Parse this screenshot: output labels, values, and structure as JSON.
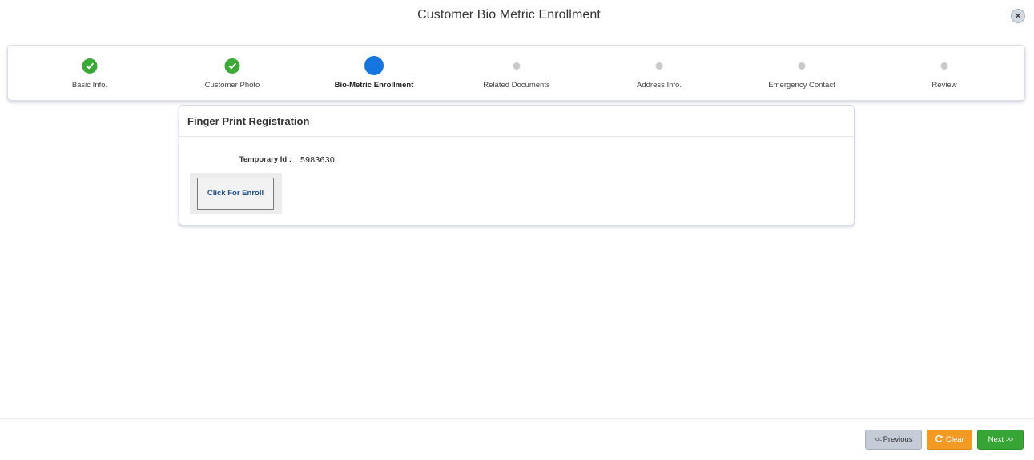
{
  "dialog": {
    "title": "Customer Bio Metric Enrollment",
    "close_glyph": "✕"
  },
  "stepper": {
    "steps": [
      {
        "label": "Basic Info.",
        "state": "completed"
      },
      {
        "label": "Customer Photo",
        "state": "completed"
      },
      {
        "label": "Bio-Metric Enrollment",
        "state": "active"
      },
      {
        "label": "Related Documents",
        "state": "pending"
      },
      {
        "label": "Address Info.",
        "state": "pending"
      },
      {
        "label": "Emergency Contact",
        "state": "pending"
      },
      {
        "label": "Review",
        "state": "pending"
      }
    ],
    "colors": {
      "completed": "#3aa935",
      "active": "#1576e0",
      "pending": "#c9c9c9"
    }
  },
  "panel": {
    "title": "Finger Print Registration",
    "temporary_id_label": "Temporary Id :",
    "temporary_id_value": "5983630",
    "enroll_button": "Click For Enroll"
  },
  "footer": {
    "previous_chevron": "<<",
    "previous_label": "Previous",
    "clear_label": "Clear",
    "clear_icon": "refresh-icon",
    "next_label": "Next",
    "next_chevron": ">>",
    "colors": {
      "previous": "#c5ccd8",
      "clear": "#f39a25",
      "next": "#36a535"
    }
  }
}
